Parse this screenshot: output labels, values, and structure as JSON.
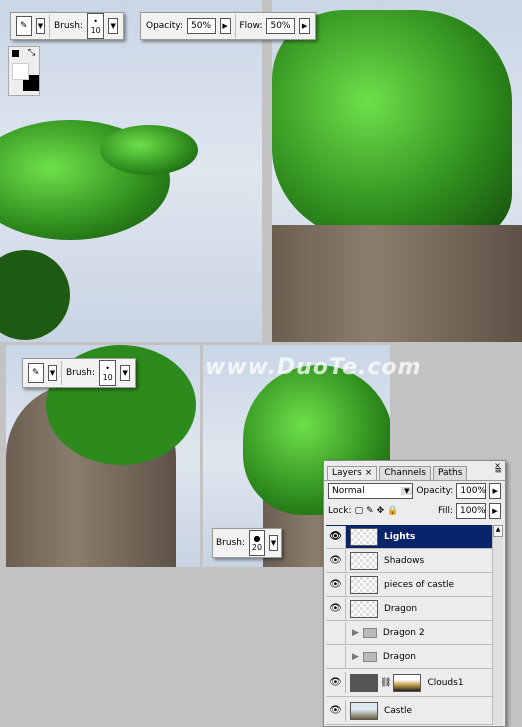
{
  "top_toolbar": {
    "brush_label": "Brush:",
    "brush_size": "10",
    "opacity_label": "Opacity:",
    "opacity_value": "50%",
    "flow_label": "Flow:",
    "flow_value": "50%"
  },
  "bottom_toolbar_1": {
    "brush_label": "Brush:",
    "brush_size": "10"
  },
  "bottom_toolbar_2": {
    "brush_label": "Brush:",
    "brush_size": "20"
  },
  "watermark": "www.DuoTe.com",
  "layers_panel": {
    "tabs": [
      {
        "label": "Layers"
      },
      {
        "label": "Channels"
      },
      {
        "label": "Paths"
      }
    ],
    "blend_mode": "Normal",
    "opacity_label": "Opacity:",
    "opacity_value": "100%",
    "lock_label": "Lock:",
    "fill_label": "Fill:",
    "fill_value": "100%",
    "layers": [
      {
        "name": "Lights",
        "visible": true,
        "selected": true
      },
      {
        "name": "Shadows",
        "visible": true
      },
      {
        "name": "pieces of castle",
        "visible": true
      },
      {
        "name": "Dragon",
        "visible": true
      },
      {
        "name": "Dragon 2",
        "visible": false,
        "group": true
      },
      {
        "name": "Dragon",
        "visible": false,
        "group": true
      },
      {
        "name": "Clouds1",
        "visible": true
      },
      {
        "name": "Castle",
        "visible": true
      }
    ]
  }
}
